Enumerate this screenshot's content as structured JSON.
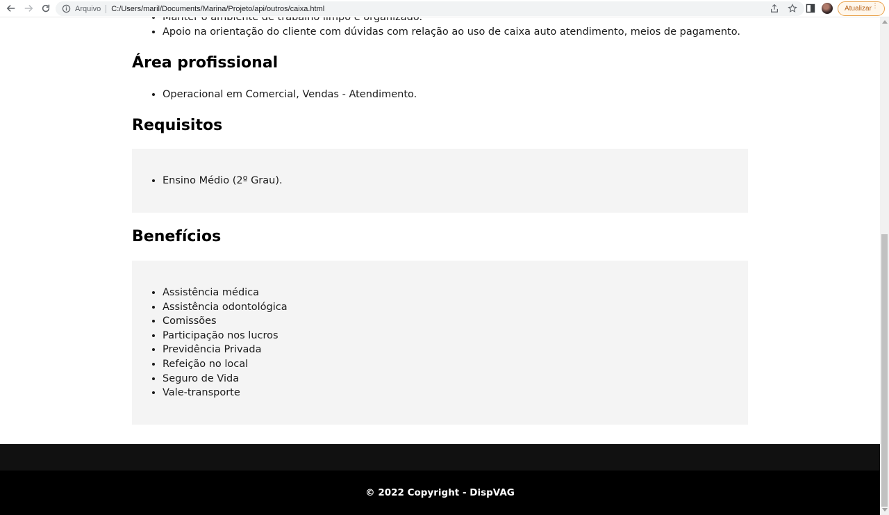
{
  "browser": {
    "scheme_label": "Arquivo",
    "url": "C:/Users/maril/Documents/Marina/Projeto/api/outros/caixa.html",
    "update_label": "Atualizar",
    "icons": [
      "back-icon",
      "forward-icon",
      "reload-icon",
      "info-icon",
      "share-icon",
      "star-icon",
      "side-panel-icon",
      "avatar",
      "menu-dots-icon"
    ]
  },
  "page": {
    "top_list": [
      "Manter o ambiente de trabalho limpo e organizado.",
      "Apoio na orientação do cliente com dúvidas com relação ao uso de caixa auto atendimento, meios de pagamento."
    ],
    "area": {
      "title": "Área profissional",
      "items": [
        "Operacional em Comercial, Vendas - Atendimento."
      ]
    },
    "requisitos": {
      "title": "Requisitos",
      "items": [
        "Ensino Médio (2º Grau)."
      ]
    },
    "beneficios": {
      "title": "Benefícios",
      "items": [
        "Assistência médica",
        "Assistência odontológica",
        "Comissões",
        "Participação nos lucros",
        "Previdência Privada",
        "Refeição no local",
        "Seguro de Vida",
        "Vale-transporte"
      ]
    },
    "footer": "© 2022 Copyright - DispVAG"
  },
  "colors": {
    "box_background": "#f4f4f4",
    "footer_background": "#000000",
    "update_accent": "#e9a24c"
  }
}
